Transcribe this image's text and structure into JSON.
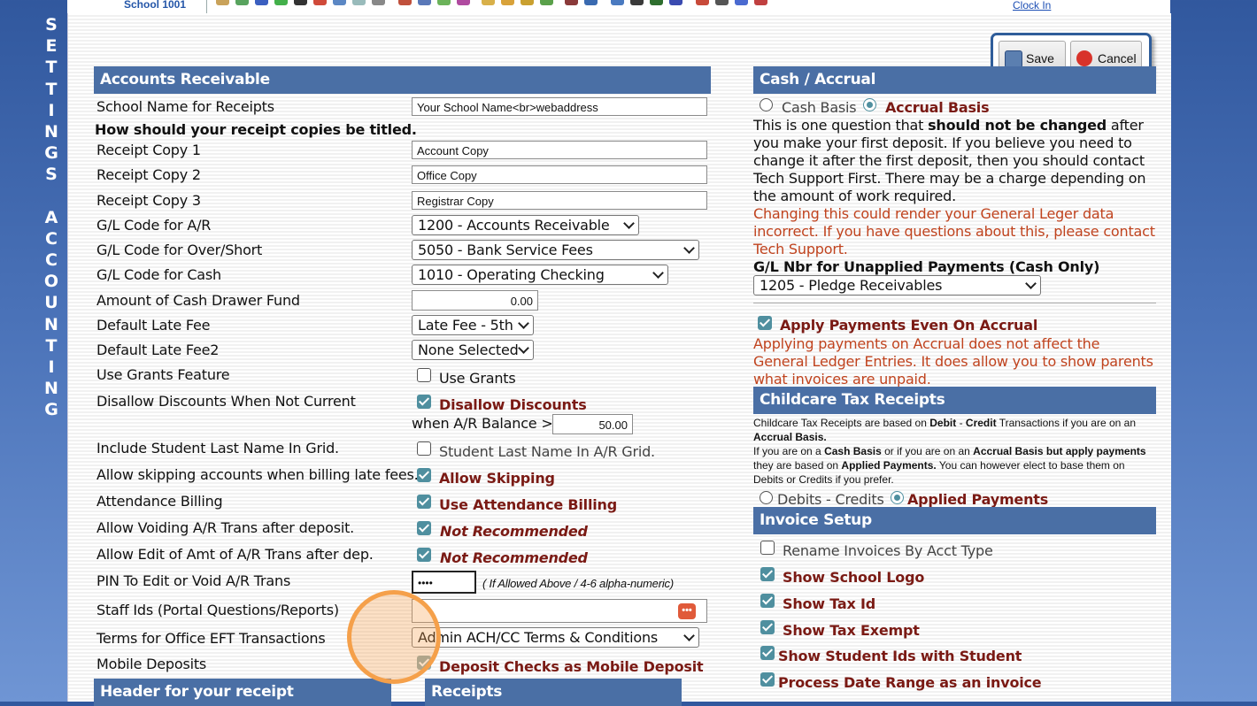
{
  "side_label": "SETTINGS ACCOUNTING",
  "topbar": {
    "school": "School 1001",
    "clock_in": "Clock In"
  },
  "actions": {
    "save": "Save",
    "cancel": "Cancel"
  },
  "ar": {
    "header": "Accounts Receivable",
    "school_name_label": "School Name for Receipts",
    "school_name_value": "Your School Name<br>webaddress",
    "copies_heading": "How should your receipt copies be titled.",
    "copy1_label": "Receipt Copy 1",
    "copy1_value": "Account Copy",
    "copy2_label": "Receipt Copy 2",
    "copy2_value": "Office Copy",
    "copy3_label": "Receipt Copy 3",
    "copy3_value": "Registrar Copy",
    "gl_ar_label": "G/L Code for A/R",
    "gl_ar_value": "1200 - Accounts Receivable",
    "gl_overshort_label": "G/L Code for Over/Short",
    "gl_overshort_value": "5050 - Bank Service Fees",
    "gl_cash_label": "G/L Code for Cash",
    "gl_cash_value": "1010 - Operating Checking",
    "drawer_label": "Amount of Cash Drawer Fund",
    "drawer_value": "0.00",
    "late_fee_label": "Default Late Fee",
    "late_fee_value": "Late Fee - 5th",
    "late_fee2_label": "Default Late Fee2",
    "late_fee2_value": "None Selected",
    "grants_label": "Use Grants Feature",
    "grants_option": "Use Grants",
    "disallow_label": "Disallow Discounts When Not Current",
    "disallow_option": "Disallow Discounts",
    "balance_label": "when A/R Balance >",
    "balance_value": "50.00",
    "lastname_label": "Include Student Last Name In Grid.",
    "lastname_option": "Student Last Name In A/R Grid.",
    "skip_label": "Allow skipping accounts when billing late fees.",
    "skip_option": "Allow Skipping",
    "attendance_label": "Attendance Billing",
    "attendance_option": "Use Attendance Billing",
    "voiding_label": "Allow Voiding A/R Trans after deposit.",
    "voiding_option": "Not Recommended",
    "edit_amt_label": "Allow Edit of Amt of A/R Trans after dep.",
    "edit_amt_option": "Not Recommended",
    "pin_label": "PIN To Edit or Void A/R Trans",
    "pin_value": "••••",
    "pin_hint": "( If Allowed Above / 4-6 alpha-numeric)",
    "staff_label": "Staff Ids (Portal Questions/Reports)",
    "staff_value": "",
    "staff_icon": "•••",
    "eft_label": "Terms for Office EFT Transactions",
    "eft_value": "Admin ACH/CC Terms & Conditions",
    "mobile_label": "Mobile Deposits",
    "mobile_option": "Deposit Checks as Mobile Deposit"
  },
  "bottom_headers": {
    "receipt_header": "Header for your receipt",
    "receipts": "Receipts"
  },
  "cash_accrual": {
    "header": "Cash / Accrual",
    "cash_option": "Cash Basis",
    "accrual_option": "Accrual Basis",
    "para_a": "This is one question that ",
    "para_b": "should not be changed",
    "para_c": " after you make your first deposit. If you believe you need to change it after the first deposit, then you should contact Tech Support First. There may be a charge depending on the amount of work required.",
    "warning": "Changing this could render your General Leger data incorrect. If you have questions about this, please contact Tech Support.",
    "unapplied_label": "G/L Nbr for Unapplied Payments (Cash Only)",
    "unapplied_value": "1205 - Pledge Receivables",
    "apply_option": "Apply Payments Even On Accrual",
    "apply_note": "Applying payments on Accrual does not affect the General Ledger Entries. It does allow you to show parents what invoices are unpaid."
  },
  "childcare": {
    "header": "Childcare Tax Receipts",
    "t1": "Childcare Tax Receipts are based on ",
    "t2": "Debit",
    "t3": " - ",
    "t4": "Credit",
    "t5": " Transactions if you are on an ",
    "t6": "Accrual Basis.",
    "t7": "If you are on a ",
    "t8": "Cash Basis",
    "t9": " or if you are on an ",
    "t10": "Accrual Basis but apply payments",
    "t11": " they are based on ",
    "t12": "Applied Payments.",
    "t13": " You can however elect to base them on Debits or Credits if you prefer.",
    "opt_debits": "Debits - Credits",
    "opt_applied": "Applied Payments"
  },
  "invoice": {
    "header": "Invoice Setup",
    "rename": "Rename Invoices By Acct Type",
    "logo": "Show School Logo",
    "tax_id": "Show Tax Id",
    "tax_exempt": "Show Tax Exempt",
    "student_ids": "Show Student Ids with Student",
    "date_range": "Process Date Range as an invoice"
  },
  "colors": {
    "header_bg": "#4a6fa5",
    "accent_check": "#4f8f9f",
    "maroon": "#7a1a14",
    "warning": "#c0431e"
  }
}
